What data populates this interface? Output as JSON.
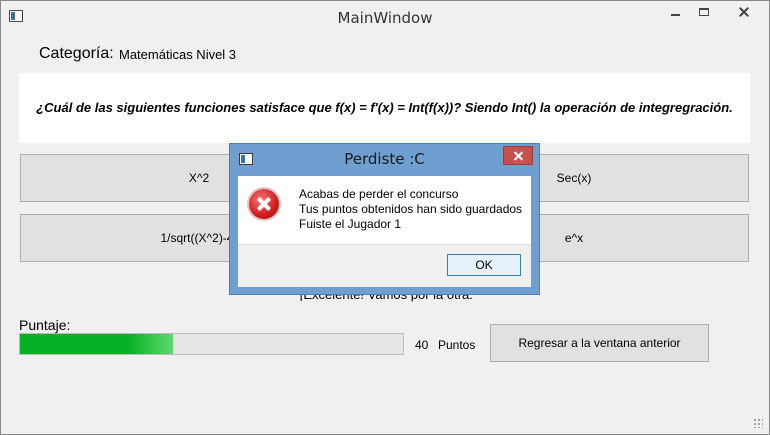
{
  "window": {
    "title": "MainWindow",
    "icon": "app-window-icon"
  },
  "category": {
    "label": "Categoría:",
    "value": "Matemáticas Nivel 3"
  },
  "question": {
    "text": "¿Cuál de las siguientes funciones satisface que f(x) = f'(x) = Int(f(x))? Siendo Int() la operación de integregración."
  },
  "answers": [
    {
      "label": "X^2"
    },
    {
      "label": "Sec(x)"
    },
    {
      "label": "1/sqrt((X^2)-4)"
    },
    {
      "label": "e^x"
    }
  ],
  "feedback": {
    "text": "¡Excelente! Vamos por la otra."
  },
  "score": {
    "label": "Puntaje:",
    "value": "40",
    "unit": "Puntos",
    "progress_fraction": 0.4
  },
  "back_button": {
    "label": "Regresar a la ventana anterior"
  },
  "dialog": {
    "title": "Perdiste :C",
    "icon": "error-icon",
    "messages": [
      "Acabas de perder el concurso",
      "Tus puntos obtenidos han sido guardados",
      "Fuiste el Jugador 1"
    ],
    "ok_label": "OK"
  },
  "colors": {
    "progress": "#06b025",
    "dialog_frame": "#6f9fd0",
    "dialog_close": "#c75050",
    "error": "#cf1d1d"
  }
}
